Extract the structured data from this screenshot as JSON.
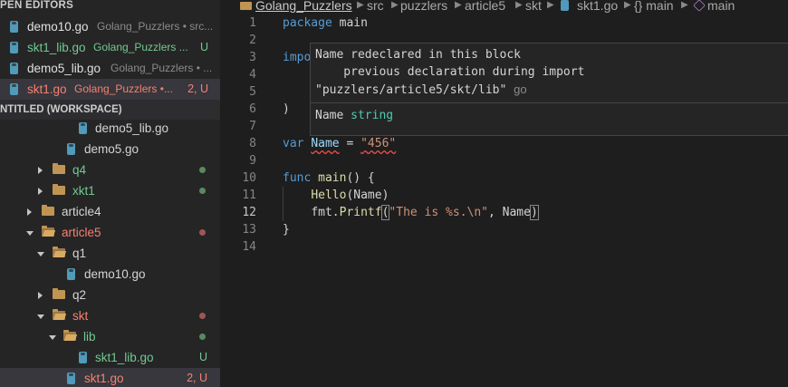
{
  "open_editors": {
    "header": "PEN EDITORS",
    "files": [
      {
        "name": "demo10.go",
        "dir": "Golang_Puzzlers • src...",
        "status": ""
      },
      {
        "name": "skt1_lib.go",
        "dir": "Golang_Puzzlers ...",
        "status": "U"
      },
      {
        "name": "demo5_lib.go",
        "dir": "Golang_Puzzlers • ...",
        "status": ""
      },
      {
        "name": "skt1.go",
        "dir": "Golang_Puzzlers •...",
        "status": "2, U"
      }
    ]
  },
  "workspace": {
    "header": "NTITLED (WORKSPACE)",
    "tree": [
      {
        "name": "demo5_lib.go"
      },
      {
        "name": "demo5.go"
      },
      {
        "name": "q4"
      },
      {
        "name": "xkt1"
      },
      {
        "name": "article4"
      },
      {
        "name": "article5"
      },
      {
        "name": "q1"
      },
      {
        "name": "demo10.go"
      },
      {
        "name": "q2"
      },
      {
        "name": "skt"
      },
      {
        "name": "lib"
      },
      {
        "name": "skt1_lib.go",
        "status": "U"
      },
      {
        "name": "skt1.go",
        "status": "2, U"
      }
    ]
  },
  "breadcrumb": {
    "items": [
      "Golang_Puzzlers",
      "src",
      "puzzlers",
      "article5",
      "skt",
      "skt1.go",
      "{} main",
      "main"
    ]
  },
  "editor": {
    "line_numbers": [
      "1",
      "2",
      "3",
      "4",
      "5",
      "6",
      "7",
      "8",
      "9",
      "10",
      "11",
      "12",
      "13",
      "14"
    ],
    "lines": {
      "l1_kw": "package",
      "l1_rest": " main",
      "l3": "impo",
      "l6": ")",
      "l8_kw": "var",
      "l8_name": "Name",
      "l8_eq": " = ",
      "l8_str": "\"456\"",
      "l10_kw": "func",
      "l10_fn": "main",
      "l10_rest": "() {",
      "l11_fn": "Hello",
      "l11_rest": "(Name)",
      "l12_pkg": "fmt.",
      "l12_fn": "Printf",
      "l12_open": "(",
      "l12_str": "\"The is %s.\\n\"",
      "l12_rest": ", Name",
      "l12_close": ")",
      "l13": "}"
    }
  },
  "hover": {
    "line1": "Name redeclared in this block",
    "line2": "    previous declaration during import",
    "line3": "\"puzzlers/article5/skt/lib\"",
    "source": "go",
    "sig_name": "Name",
    "sig_type": "string"
  },
  "colors": {
    "accent_blue": "#569cd6",
    "modified_green": "#73c991",
    "error_red": "#f88070"
  }
}
